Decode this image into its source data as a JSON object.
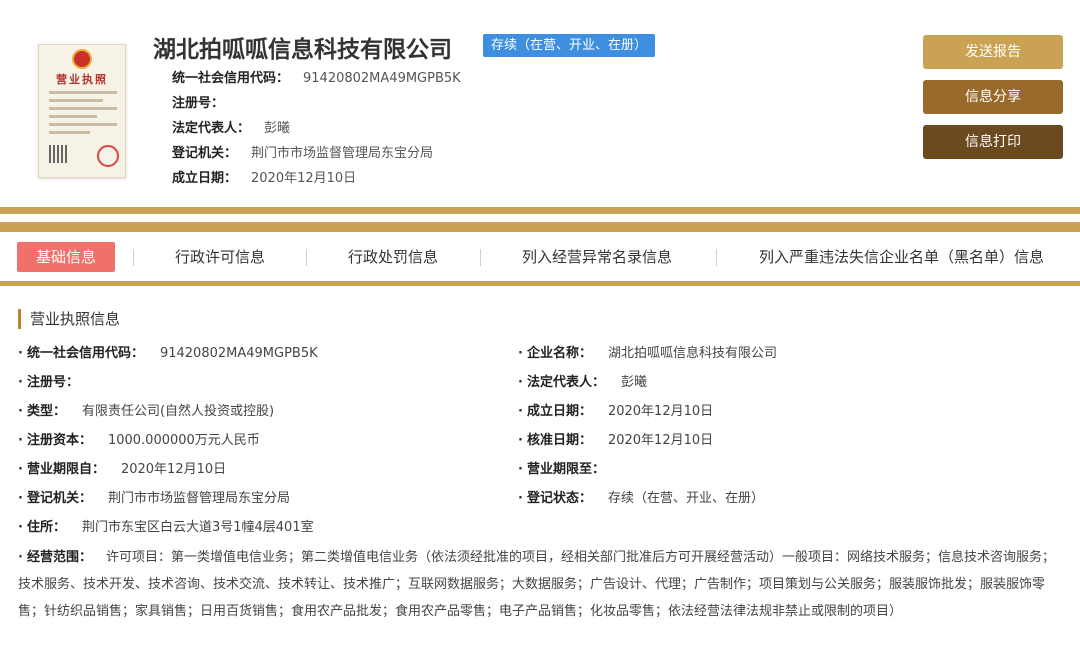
{
  "license_image": {
    "title": "营业执照"
  },
  "company": {
    "name": "湖北拍呱呱信息科技有限公司",
    "status": "存续（在营、开业、在册）"
  },
  "header_info": [
    {
      "label": "统一社会信用代码：",
      "value": "91420802MA49MGPB5K"
    },
    {
      "label": "注册号：",
      "value": ""
    },
    {
      "label": "法定代表人：",
      "value": "彭曦"
    },
    {
      "label": "登记机关：",
      "value": "荆门市市场监督管理局东宝分局"
    },
    {
      "label": "成立日期：",
      "value": "2020年12月10日"
    }
  ],
  "buttons": {
    "send": "发送报告",
    "share": "信息分享",
    "print": "信息打印"
  },
  "tabs": [
    {
      "label": "基础信息",
      "active": true
    },
    {
      "label": "行政许可信息",
      "active": false
    },
    {
      "label": "行政处罚信息",
      "active": false
    },
    {
      "label": "列入经营异常名录信息",
      "active": false
    },
    {
      "label": "列入严重违法失信企业名单（黑名单）信息",
      "active": false
    }
  ],
  "section": {
    "title": "营业执照信息",
    "left_fields": [
      {
        "label": "统一社会信用代码：",
        "value": "91420802MA49MGPB5K"
      },
      {
        "label": "注册号：",
        "value": ""
      },
      {
        "label": "类型：",
        "value": "有限责任公司(自然人投资或控股)"
      },
      {
        "label": "注册资本：",
        "value": "1000.000000万元人民币"
      },
      {
        "label": "营业期限自：",
        "value": "2020年12月10日"
      },
      {
        "label": "登记机关：",
        "value": "荆门市市场监督管理局东宝分局"
      },
      {
        "label": "住所：",
        "value": "荆门市东宝区白云大道3号1幢4层401室"
      }
    ],
    "right_fields": [
      {
        "label": "企业名称：",
        "value": "湖北拍呱呱信息科技有限公司"
      },
      {
        "label": "法定代表人：",
        "value": "彭曦"
      },
      {
        "label": "成立日期：",
        "value": "2020年12月10日"
      },
      {
        "label": "核准日期：",
        "value": "2020年12月10日"
      },
      {
        "label": "营业期限至：",
        "value": ""
      },
      {
        "label": "登记状态：",
        "value": "存续（在营、开业、在册）"
      }
    ],
    "scope": {
      "label": "经营范围：",
      "value": "许可项目：第一类增值电信业务；第二类增值电信业务（依法须经批准的项目，经相关部门批准后方可开展经营活动）一般项目：网络技术服务；信息技术咨询服务；技术服务、技术开发、技术咨询、技术交流、技术转让、技术推广；互联网数据服务；大数据服务；广告设计、代理；广告制作；项目策划与公关服务；服装服饰批发；服装服饰零售；针纺织品销售；家具销售；日用百货销售；食用农产品批发；食用农产品零售；电子产品销售；化妆品零售；依法经营法律法规非禁止或限制的项目）"
    }
  },
  "colors": {
    "gold": "#c9a253",
    "brown": "#9a6a2a",
    "dark_brown": "#6b4a1f",
    "status_blue": "#3f8fe0",
    "active_tab": "#f0716b"
  }
}
